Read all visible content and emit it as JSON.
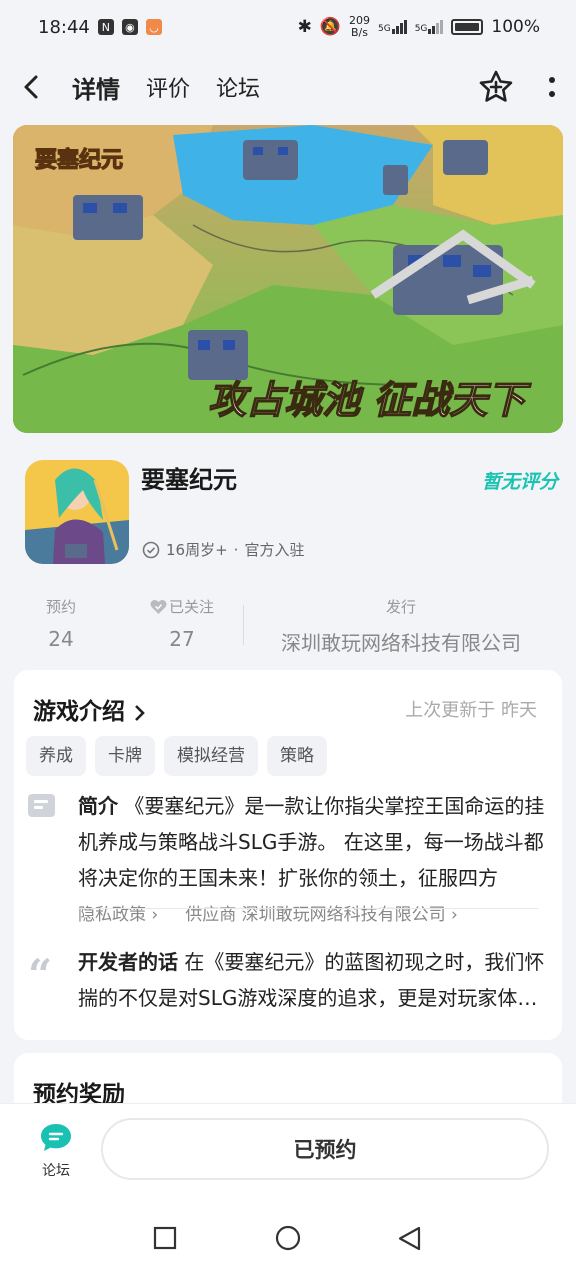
{
  "status": {
    "time": "18:44",
    "net_speed_value": "209",
    "net_speed_unit": "B/s",
    "signal1": "5G",
    "signal2": "5G",
    "battery": "100%"
  },
  "nav": {
    "tabs": [
      {
        "label": "详情",
        "active": true
      },
      {
        "label": "评价",
        "active": false
      },
      {
        "label": "论坛",
        "active": false
      }
    ]
  },
  "banner": {
    "logo_text": "要塞纪元",
    "slogan": "攻占城池 征战天下"
  },
  "app": {
    "name": "要塞纪元",
    "rating": "暂无评分",
    "age": "16周岁+",
    "meta_sep": "·",
    "official": "官方入驻"
  },
  "stats": {
    "reserve_label": "预约",
    "reserve_value": "24",
    "follow_label": "已关注",
    "follow_value": "27",
    "publisher_label": "发行",
    "publisher_value": "深圳敢玩网络科技有限公司"
  },
  "intro": {
    "title": "游戏介绍",
    "updated": "上次更新于 昨天",
    "tags": [
      "养成",
      "卡牌",
      "模拟经营",
      "策略"
    ],
    "desc_label": "简介",
    "desc_text": "《要塞纪元》是一款让你指尖掌控王国命运的挂机养成与策略战斗SLG手游。 在这里，每一场战斗都将决定你的王国未来！扩张你的领土，征服四方",
    "privacy_link": "隐私政策",
    "supplier_link": "供应商 深圳敢玩网络科技有限公司",
    "dev_label": "开发者的话",
    "dev_text": "在《要塞纪元》的蓝图初现之时，我们怀揣的不仅是对SLG游戏深度的追求，更是对玩家体验的执着"
  },
  "reward": {
    "title": "预约奖励"
  },
  "bottom": {
    "forum_label": "论坛",
    "reserve_button": "已预约"
  },
  "colors": {
    "accent": "#1cc3b2",
    "background": "#f2f4f7"
  }
}
